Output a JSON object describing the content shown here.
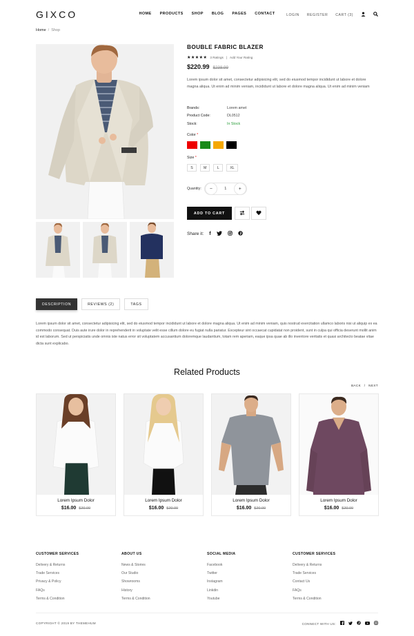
{
  "brand": {
    "logo": "GIXCO"
  },
  "nav": [
    {
      "label": "HOME"
    },
    {
      "label": "PRODUCTS"
    },
    {
      "label": "SHOP"
    },
    {
      "label": "BLOG"
    },
    {
      "label": "PAGES"
    },
    {
      "label": "CONTACT"
    }
  ],
  "header": {
    "login": "LOGIN",
    "register": "REGISTER",
    "cart": "CART (3)"
  },
  "breadcrumb": {
    "home": "Home",
    "sep": "/",
    "current": "Shop"
  },
  "product": {
    "title": "BOUBLE FABRIC BLAZER",
    "stars": "★★★★★",
    "ratings": "3 Ratings",
    "rating_sep": "|",
    "add_rating": "Add Your Rating",
    "price": "$220.99",
    "old_price": "$238.99",
    "description": "Lorem ipsum dolor sit amet, consectetur adipisicing elit, sed do eiusmod tempor incididunt ut labore et dolore magna aliqua. Ut enim ad minim veniam, incididunt ut labore et dolore magna aliqua. Ut enim ad minim veniam",
    "meta": [
      {
        "key": "Brands:",
        "value": "Lorem amet"
      },
      {
        "key": "Product Code:",
        "value": "DL0512"
      },
      {
        "key": "Stock:",
        "value": "In Stock"
      }
    ],
    "color_label": "Color",
    "colors": [
      "#ee0000",
      "#1a8a1a",
      "#f5a800",
      "#000000"
    ],
    "size_label": "Size",
    "required_mark": "*",
    "sizes": [
      "S",
      "M",
      "L",
      "XL"
    ],
    "quantity_label": "Quantity:",
    "quantity": "1",
    "minus": "−",
    "plus": "+",
    "add_to_cart": "ADD TO CART",
    "share_label": "Share it:"
  },
  "tabs": [
    {
      "label": "DESCRIPTION"
    },
    {
      "label": "REVIEWS (2)"
    },
    {
      "label": "TAGS"
    }
  ],
  "long_description": "Lorem ipsum dolor sit amet, consectetur adipisicing elit, sed do eiusmod tempor incididunt ut labore et dolore magna aliqua. Ut enim ad minim veniam, quis nostrud exercitation ullamco laboris nisi ut aliquip ex ea commodo consequat. Duis aute irure dolor in reprehenderit in voluptate velit esse cillum dolore eu fugiat nulla pariatur. Excepteur sint occaecat cupidatat non proident, sunt in culpa qui officia deserunt mollit anim id est laborum. Sed ut perspiciatis unde omnis iste natus error sit voluptatem accusantium doloremque laudantium, totam rem aperiam, eaque ipsa quae ab illo inventore veritatis et quasi architecto beatae vitae dicta sunt explicabo.",
  "related": {
    "title": "Related Products",
    "back": "BACK",
    "sep": "/",
    "next": "NEXT",
    "items": [
      {
        "name": "Lorem Ipsum Dolor",
        "price": "$16.00",
        "old": "$20.00"
      },
      {
        "name": "Lorem Ipsum Dolor",
        "price": "$16.00",
        "old": "$20.00"
      },
      {
        "name": "Lorem Ipsum Dolor",
        "price": "$16.00",
        "old": "$20.00"
      },
      {
        "name": "Lorem Ipsum Dolor",
        "price": "$16.00",
        "old": "$20.00"
      }
    ]
  },
  "footer": {
    "columns": [
      {
        "title": "CUSTOMER SERVICES",
        "links": [
          "Delivery & Returns",
          "Trade Services",
          "Privacy & Policy",
          "FAQs",
          "Terms & Condition"
        ]
      },
      {
        "title": "ABOUT US",
        "links": [
          "News & Stories",
          "Our Studio",
          "Showrooms",
          "History",
          "Terms & Condition"
        ]
      },
      {
        "title": "SOCIAL MEDIA",
        "links": [
          "Facebook",
          "Twitter",
          "Instagram",
          "Linkdin",
          "Youtube"
        ]
      },
      {
        "title": "CUSTOMER SERVICES",
        "links": [
          "Delivery & Returns",
          "Trade Services",
          "Contact Us",
          "FAQs",
          "Terms & Condition"
        ]
      }
    ],
    "copyright": "COPYRIGHT © 2019 BY THEMEHUM",
    "connect": "CONNECT WITH US:"
  }
}
